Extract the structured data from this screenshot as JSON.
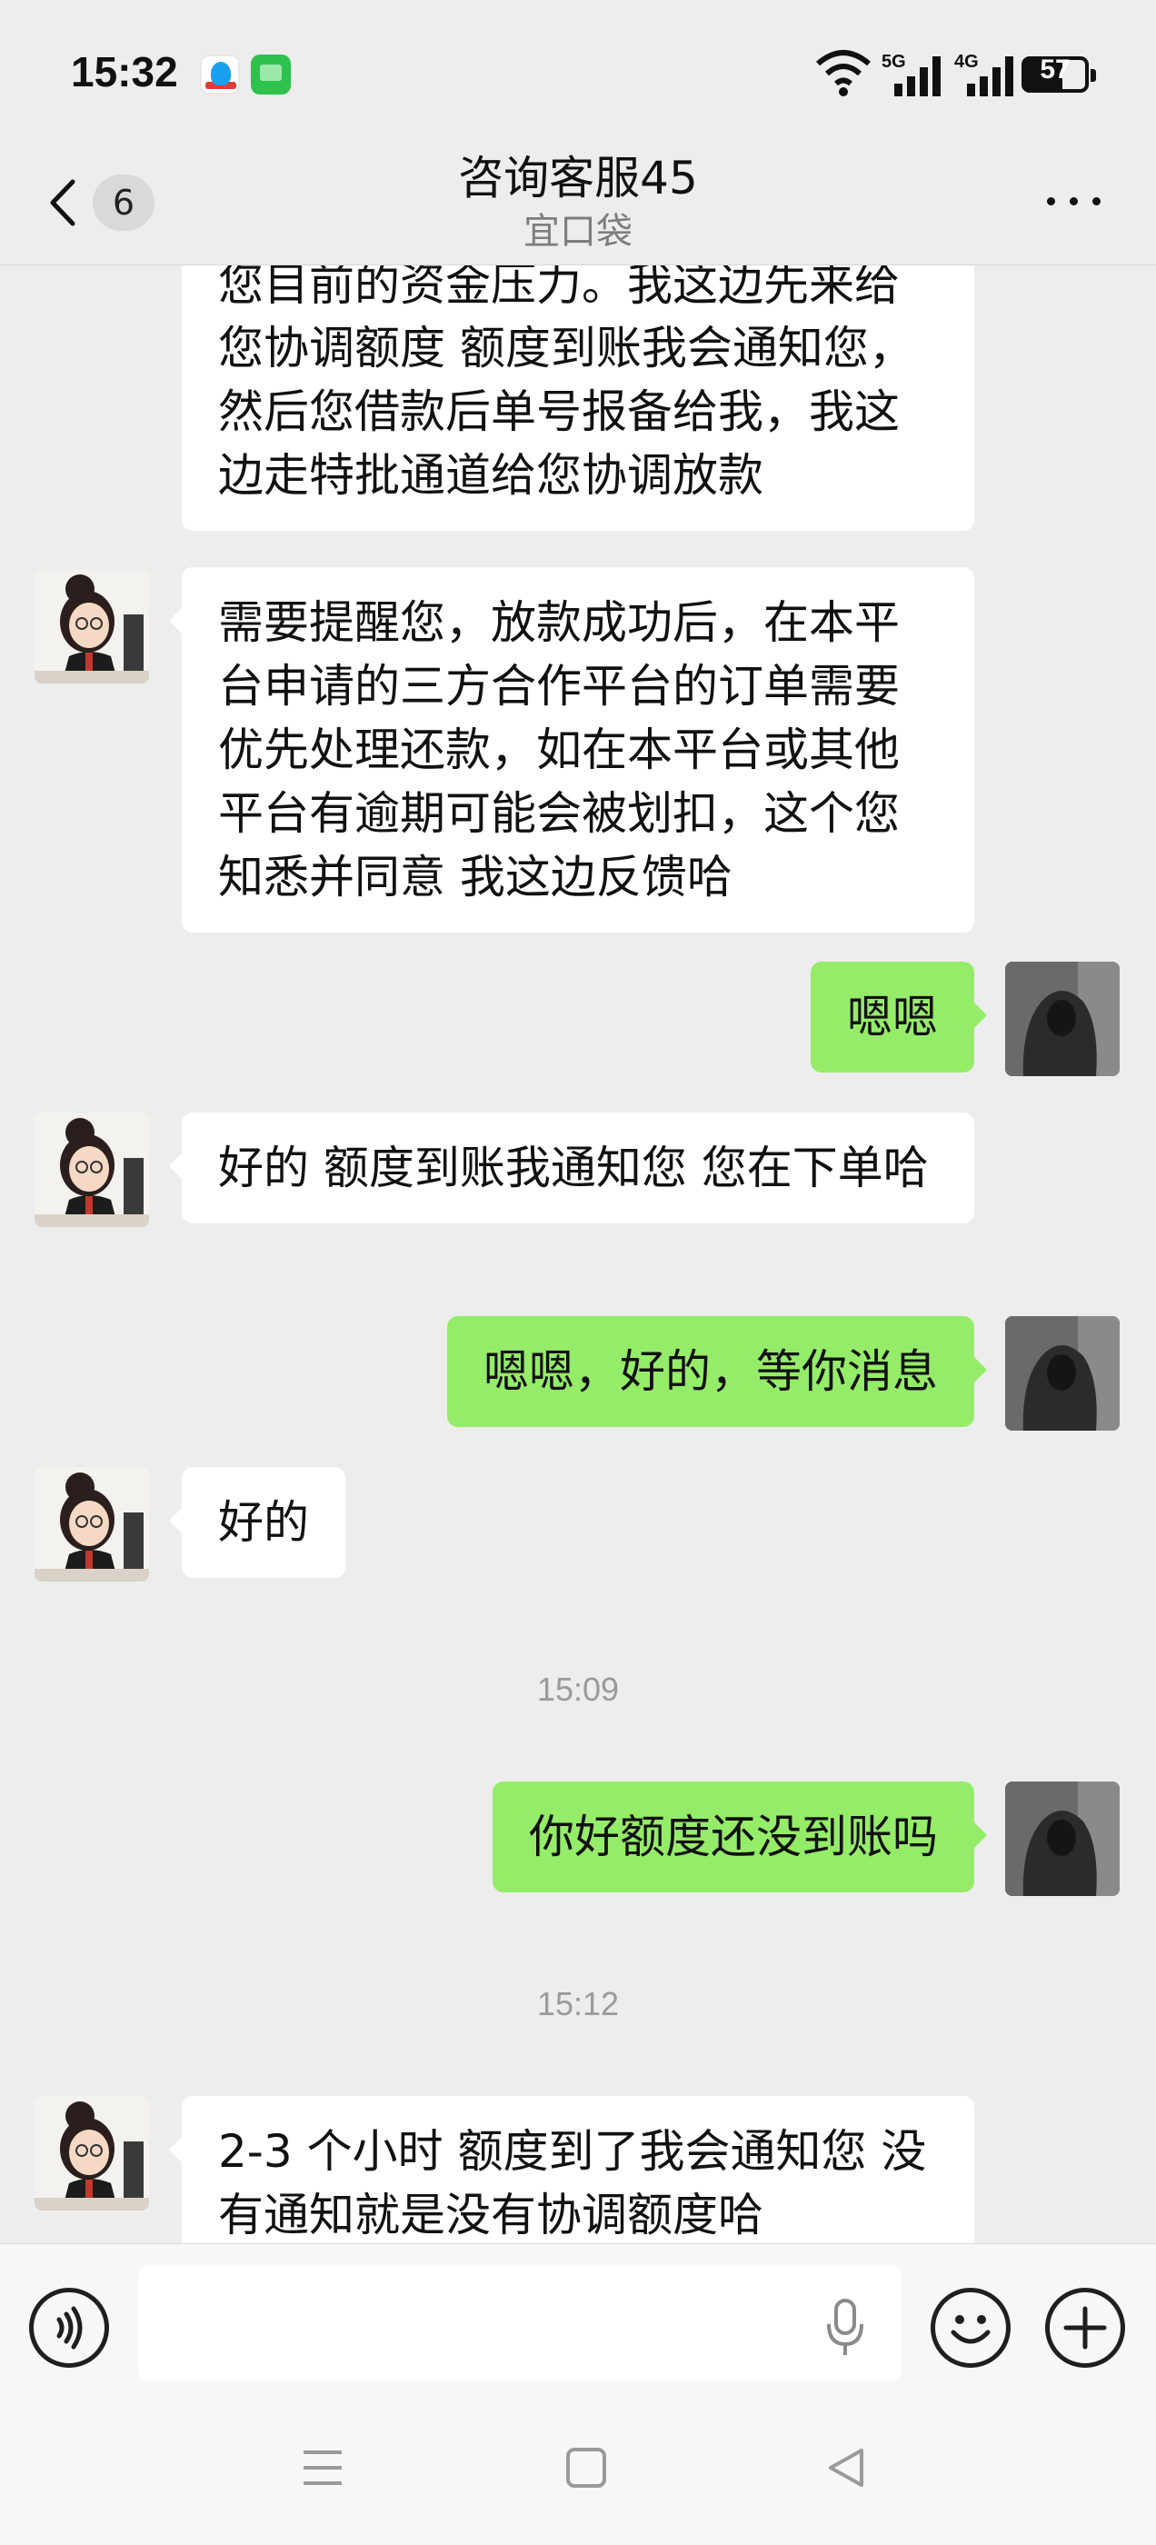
{
  "status_bar": {
    "time": "15:32",
    "battery": "57",
    "net1": "5G",
    "net2": "4G"
  },
  "header": {
    "back_badge": "6",
    "title": "咨询客服45",
    "subtitle": "宜口袋"
  },
  "messages": [
    {
      "side": "left",
      "text": "您目前的资金压力。我这边先来给您协调额度 额度到账我会通知您，然后您借款后单号报备给我，我这边走特批通道给您协调放款"
    },
    {
      "side": "left",
      "text": "需要提醒您，放款成功后，在本平台申请的三方合作平台的订单需要优先处理还款，如在本平台或其他平台有逾期可能会被划扣，这个您知悉并同意 我这边反馈哈"
    },
    {
      "side": "right",
      "text": "嗯嗯"
    },
    {
      "side": "left",
      "text": "好的  额度到账我通知您 您在下单哈"
    },
    {
      "side": "right",
      "text": "嗯嗯，好的，等你消息"
    },
    {
      "side": "left",
      "text": "好的"
    },
    {
      "side": "time",
      "text": "15:09"
    },
    {
      "side": "right",
      "text": "你好额度还没到账吗"
    },
    {
      "side": "time",
      "text": "15:12"
    },
    {
      "side": "left",
      "text": "2-3 个小时 额度到了我会通知您 没有通知就是没有协调额度哈"
    }
  ],
  "icons": {
    "back": "chevron-left-icon",
    "more": "more-dots-icon",
    "voice": "voice-icon",
    "mic": "mic-icon",
    "emoji": "emoji-icon",
    "plus": "plus-icon"
  },
  "colors": {
    "sent_bubble": "#95ec69",
    "received_bubble": "#ffffff",
    "background": "#ededed"
  }
}
